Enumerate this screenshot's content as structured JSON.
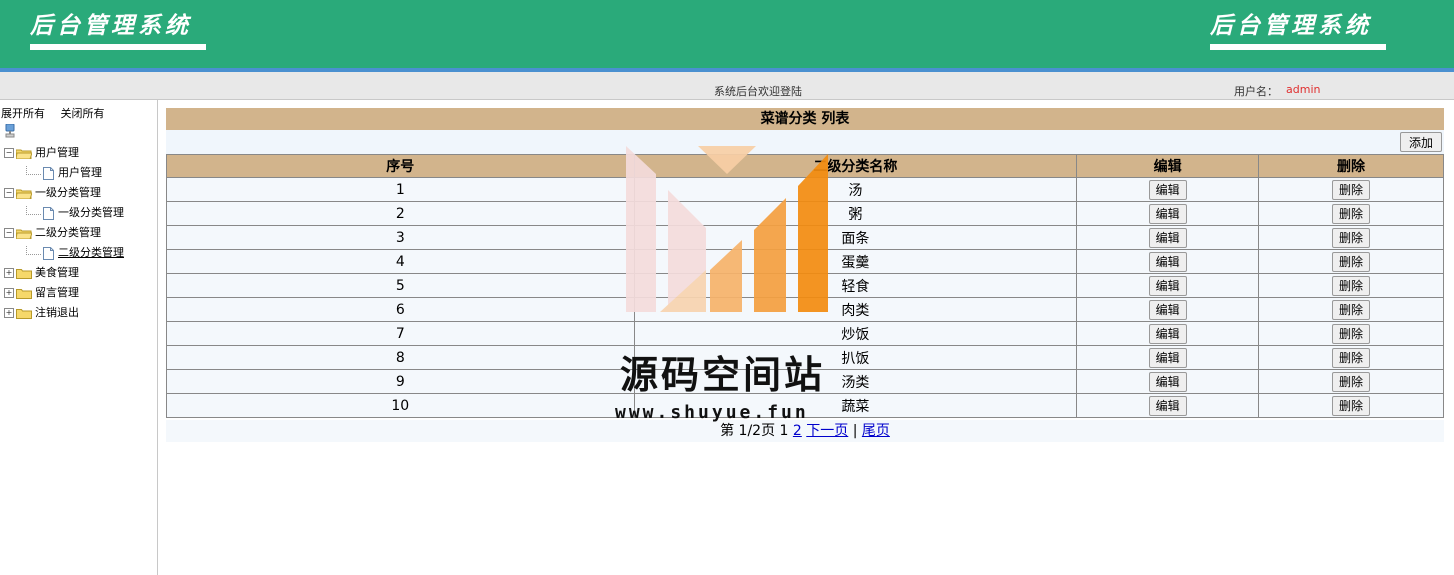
{
  "header": {
    "logo_left": "后台管理系统",
    "logo_right": "后台管理系统",
    "welcome": "系统后台欢迎登陆",
    "user_label": "用户名：",
    "user_name": "admin"
  },
  "sidebar": {
    "expand_all": "展开所有",
    "collapse_all": "关闭所有",
    "nodes": [
      {
        "label": "用户管理",
        "type": "folder-open"
      },
      {
        "label": "用户管理",
        "type": "page"
      },
      {
        "label": "一级分类管理",
        "type": "folder-open"
      },
      {
        "label": "一级分类管理",
        "type": "page"
      },
      {
        "label": "二级分类管理",
        "type": "folder-open"
      },
      {
        "label": "二级分类管理",
        "type": "page",
        "active": true
      },
      {
        "label": "美食管理",
        "type": "folder"
      },
      {
        "label": "留言管理",
        "type": "folder"
      },
      {
        "label": "注销退出",
        "type": "folder"
      }
    ]
  },
  "main": {
    "title": "菜谱分类 列表",
    "add_button": "添加",
    "columns": [
      "序号",
      "二级分类名称",
      "编辑",
      "删除"
    ],
    "edit_label": "编辑",
    "delete_label": "删除",
    "rows": [
      {
        "index": "1",
        "name": "汤"
      },
      {
        "index": "2",
        "name": "粥"
      },
      {
        "index": "3",
        "name": "面条"
      },
      {
        "index": "4",
        "name": "蛋羹"
      },
      {
        "index": "5",
        "name": "轻食"
      },
      {
        "index": "6",
        "name": "肉类"
      },
      {
        "index": "7",
        "name": "炒饭"
      },
      {
        "index": "8",
        "name": "扒饭"
      },
      {
        "index": "9",
        "name": "汤类"
      },
      {
        "index": "10",
        "name": "蔬菜"
      }
    ],
    "pager": {
      "prefix": "第 1/2页 1",
      "page2": "2",
      "next": "下一页",
      "sep": "|",
      "last": "尾页"
    }
  },
  "watermark": {
    "title": "源码空间站",
    "url": "www.shuyue.fun"
  },
  "colors": {
    "header": "#2aaa7a",
    "table_header": "#d2b48c",
    "user_name": "#e03030",
    "link": "#0000cc"
  }
}
